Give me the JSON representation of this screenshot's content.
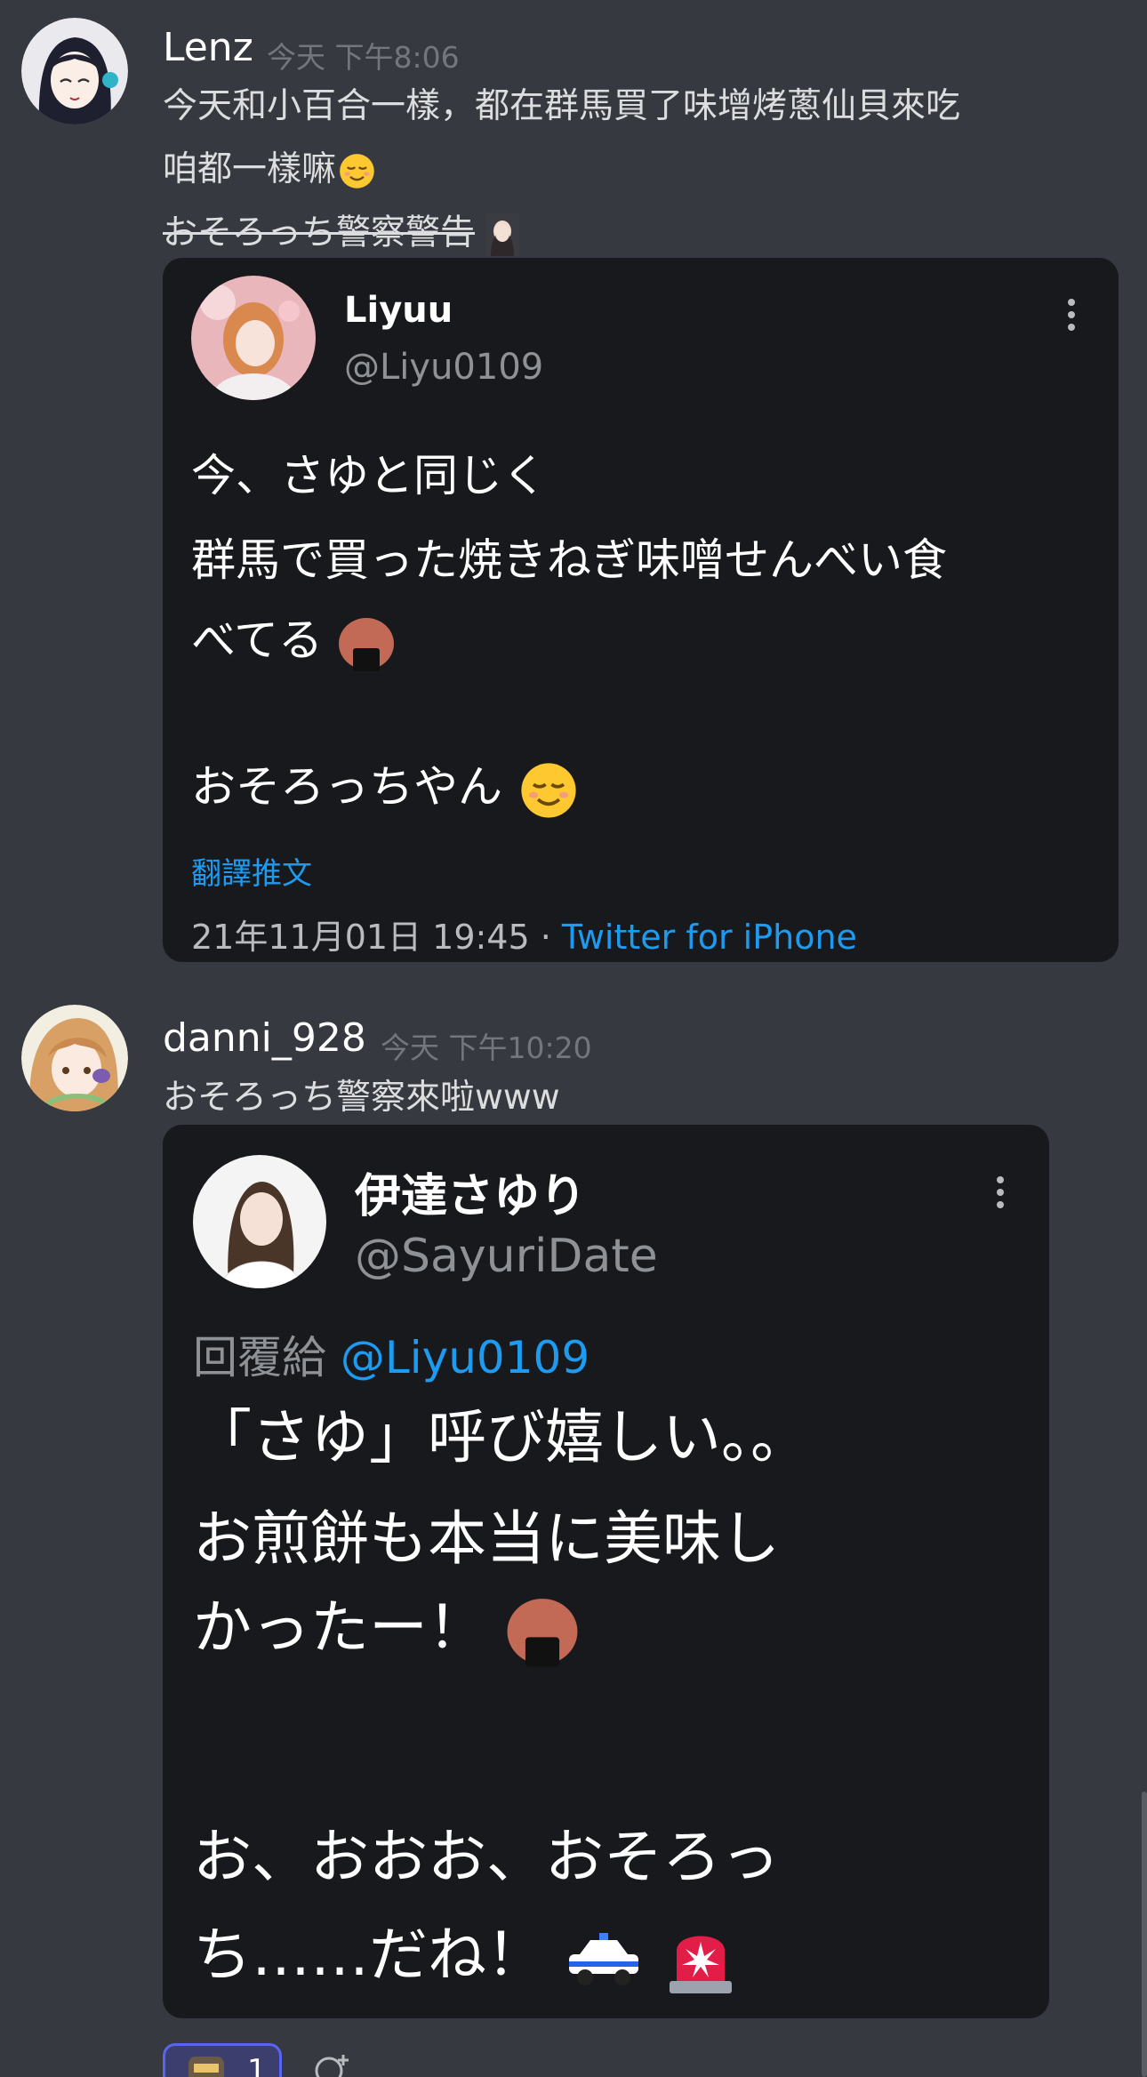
{
  "messages": [
    {
      "author": "Lenz",
      "timestamp": "今天 下午8:06",
      "lines": [
        "今天和小百合一樣，都在群馬買了味增烤蔥仙貝來吃",
        "咱都一樣嘛",
        "おそろっち警察警告"
      ],
      "embed": {
        "display_name": "Liyuu",
        "handle": "@Liyu0109",
        "text_lines": [
          "今、さゆと同じく",
          "群馬で買った焼きねぎ味噌せんべい食",
          "べてる",
          "おそろっちやん"
        ],
        "translate_link": "翻譯推文",
        "date": "21年11月01日 19:45 · ",
        "source": "Twitter for iPhone"
      }
    },
    {
      "author": "danni_928",
      "timestamp": "今天 下午10:20",
      "lines": [
        "おそろっち警察來啦www"
      ],
      "embed": {
        "display_name": "伊達さゆり",
        "handle": "@SayuriDate",
        "reply_prefix": "回覆給 ",
        "reply_handle": "@Liyu0109",
        "text_lines": [
          "「さゆ」呼び嬉しい。。",
          "お煎餅も本当に美味し",
          "かったー！",
          "お、おおお、おそろっ",
          "ち……だね！"
        ]
      }
    }
  ],
  "reaction": {
    "count": "1",
    "icon": "reaction-emoji-icon"
  },
  "icons": {
    "relieved": "relieved-face-icon",
    "onigiri": "rice-ball-icon",
    "police_car": "police-car-icon",
    "siren": "police-siren-icon",
    "more": "more-options-icon",
    "add_reaction": "add-reaction-icon"
  }
}
